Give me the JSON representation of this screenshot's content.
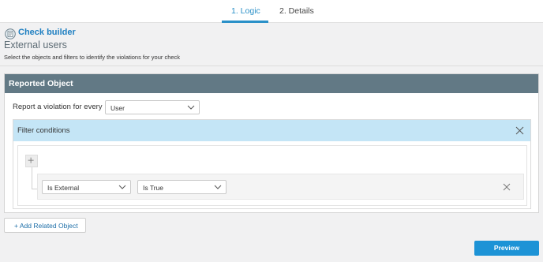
{
  "tabs": [
    {
      "label": "1. Logic",
      "active": true
    },
    {
      "label": "2. Details",
      "active": false
    }
  ],
  "header": {
    "builder_link": "Check builder",
    "title": "External users",
    "subtitle": "Select the objects and filters to identify the violations for your check"
  },
  "reported_object": {
    "title": "Reported Object",
    "report_label": "Report a violation for every",
    "object_select": {
      "selected": "User"
    },
    "filter_conditions": {
      "title": "Filter conditions",
      "conditions": [
        {
          "field": "Is External",
          "operator": "Is True"
        }
      ]
    }
  },
  "actions": {
    "add_related": "+ Add Related Object",
    "preview": "Preview"
  },
  "colors": {
    "accent": "#2a90c8",
    "panel_header": "#627985",
    "filter_header": "#c4e5f6",
    "preview_button": "#1d93d6"
  },
  "icons": [
    "check-builder-icon",
    "chevron-down-icon",
    "close-icon",
    "plus-icon"
  ]
}
